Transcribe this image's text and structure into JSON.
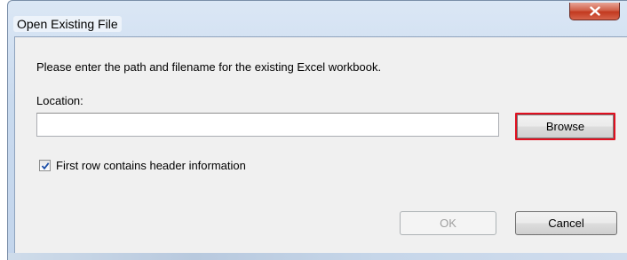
{
  "window": {
    "title": "Open Existing File"
  },
  "dialog": {
    "prompt": "Please enter the path and filename for the existing Excel workbook.",
    "location_label": "Location:",
    "location_value": "",
    "location_placeholder": "",
    "browse_label": "Browse",
    "header_checkbox": {
      "label": "First row contains header information",
      "checked": true
    },
    "ok_label": "OK",
    "cancel_label": "Cancel"
  },
  "colors": {
    "highlight_border": "#e01020",
    "close_button": "#c2391f",
    "checkmark": "#1c4fa8"
  },
  "icons": {
    "close": "close-icon",
    "check": "check-icon"
  }
}
